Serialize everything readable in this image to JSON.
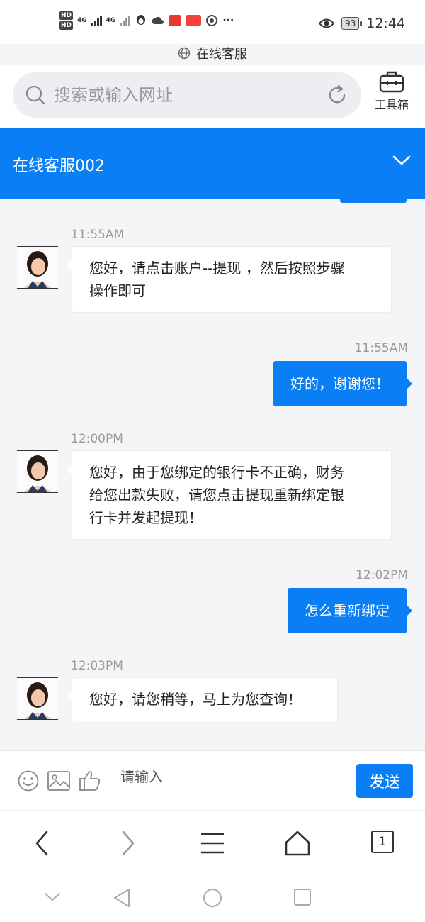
{
  "status_bar": {
    "network_left": "4G",
    "network_right": "4G",
    "more": "···",
    "battery": "93",
    "time": "12:44"
  },
  "page_label": "在线客服",
  "search": {
    "placeholder": "搜索或输入网址",
    "toolbox_label": "工具箱"
  },
  "chat": {
    "title": "在线客服002",
    "messages": [
      {
        "from": "agent",
        "time": "11:55AM",
        "text_lines": [
          "您好，请点击账户--提现 ，然后按照步骤",
          "操作即可"
        ]
      },
      {
        "from": "user",
        "time": "11:55AM",
        "text": "好的，谢谢您！"
      },
      {
        "from": "agent",
        "time": "12:00PM",
        "text_lines": [
          "您好，由于您绑定的银行卡不正确，财务",
          "给您出款失败，请您点击提现重新绑定银",
          "行卡并发起提现！"
        ]
      },
      {
        "from": "user",
        "time": "12:02PM",
        "text": "怎么重新绑定"
      },
      {
        "from": "agent",
        "time": "12:03PM",
        "text_lines": [
          "您好，请您稍等，马上为您查询！"
        ]
      }
    ]
  },
  "input_bar": {
    "placeholder": "请输入",
    "send_label": "发送"
  },
  "browser_nav": {
    "tab_count": "1"
  },
  "colors": {
    "accent": "#0a7ff5",
    "chat_background": "#f5f5f7"
  }
}
